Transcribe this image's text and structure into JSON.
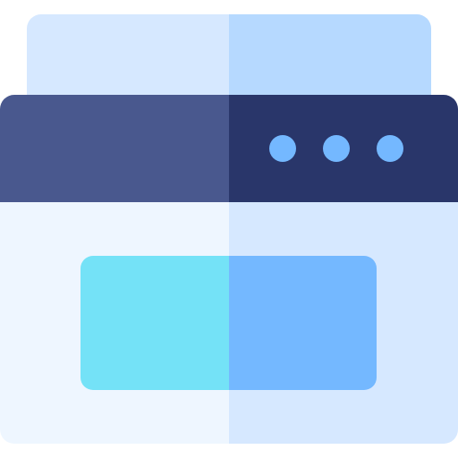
{
  "icon": {
    "name": "printer-icon",
    "colors": {
      "paper_light": "#d6e8ff",
      "paper_shade": "#b6d9ff",
      "top_band_light": "#49588e",
      "top_band_shade": "#29366a",
      "indicator_dots": "#74b8ff",
      "body_light": "#eef6ff",
      "body_shade": "#d6e8ff",
      "slot_light": "#74e2f7",
      "slot_shade": "#74b8ff"
    }
  }
}
